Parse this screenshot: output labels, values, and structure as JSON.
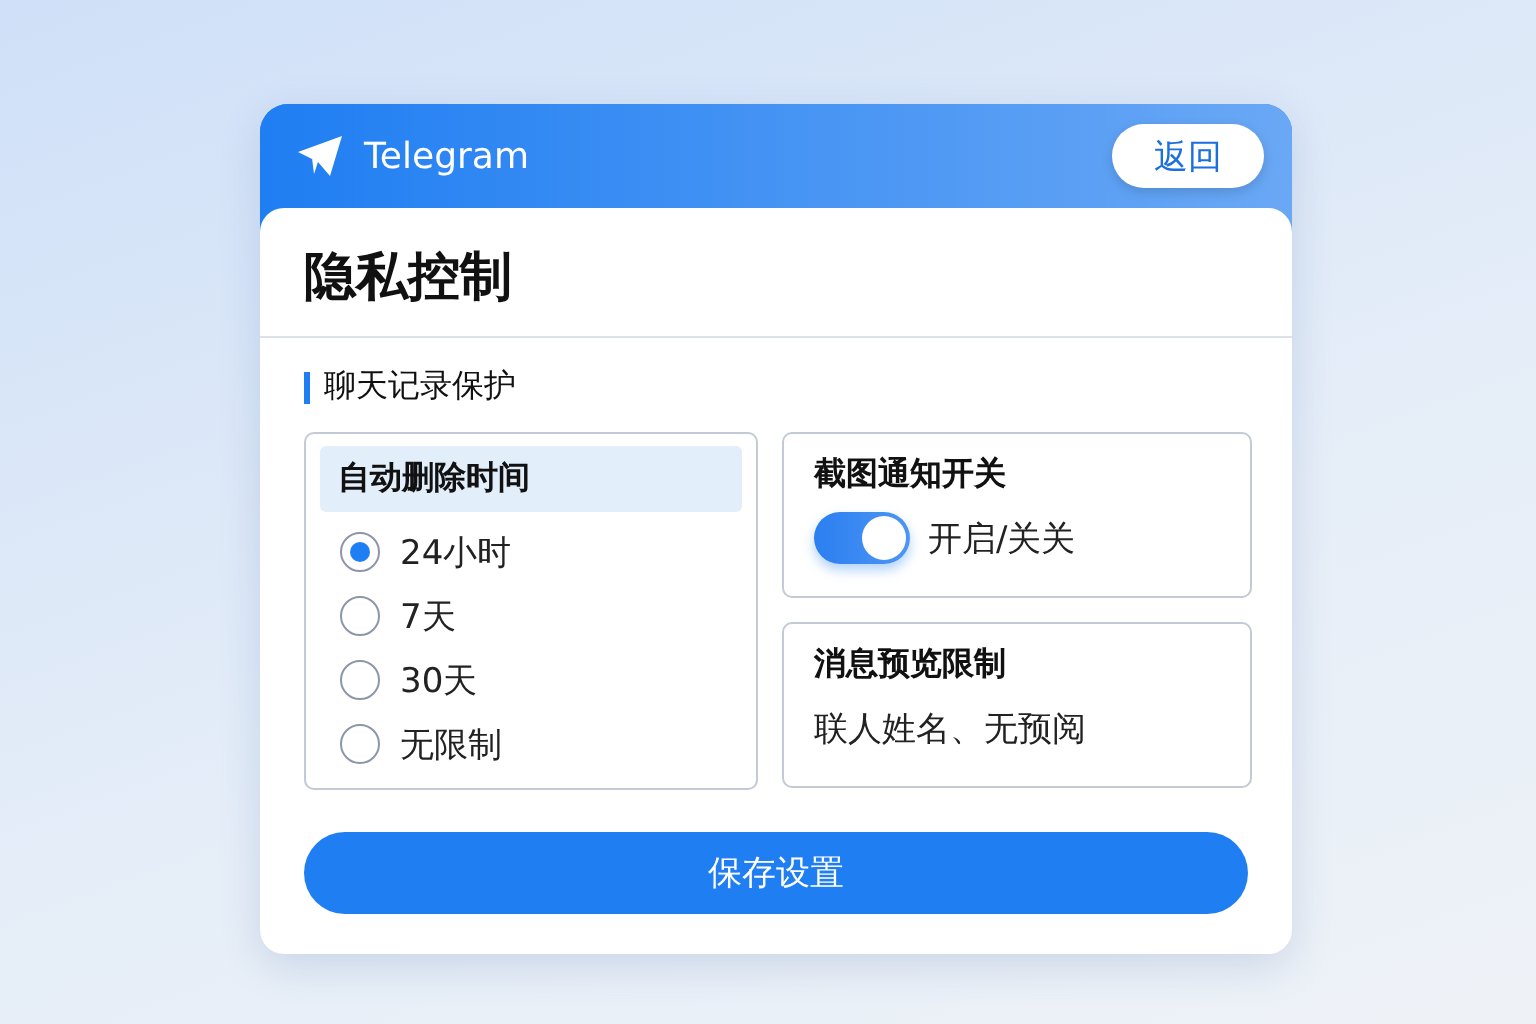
{
  "header": {
    "app_name": "Telegram",
    "back_button": "返回"
  },
  "title": "隐私控制",
  "section": {
    "label": "聊天记录保护"
  },
  "auto_delete": {
    "title": "自动删除时间",
    "options": [
      {
        "label": "24小时",
        "selected": true
      },
      {
        "label": "7天",
        "selected": false
      },
      {
        "label": "30天",
        "selected": false
      },
      {
        "label": "无限制",
        "selected": false
      }
    ]
  },
  "screenshot_notify": {
    "title": "截图通知开关",
    "on": true,
    "label": "开启/关关"
  },
  "preview_limit": {
    "title": "消息预览限制",
    "value": "联人姓名、无预阅"
  },
  "save_button": "保存设置"
}
